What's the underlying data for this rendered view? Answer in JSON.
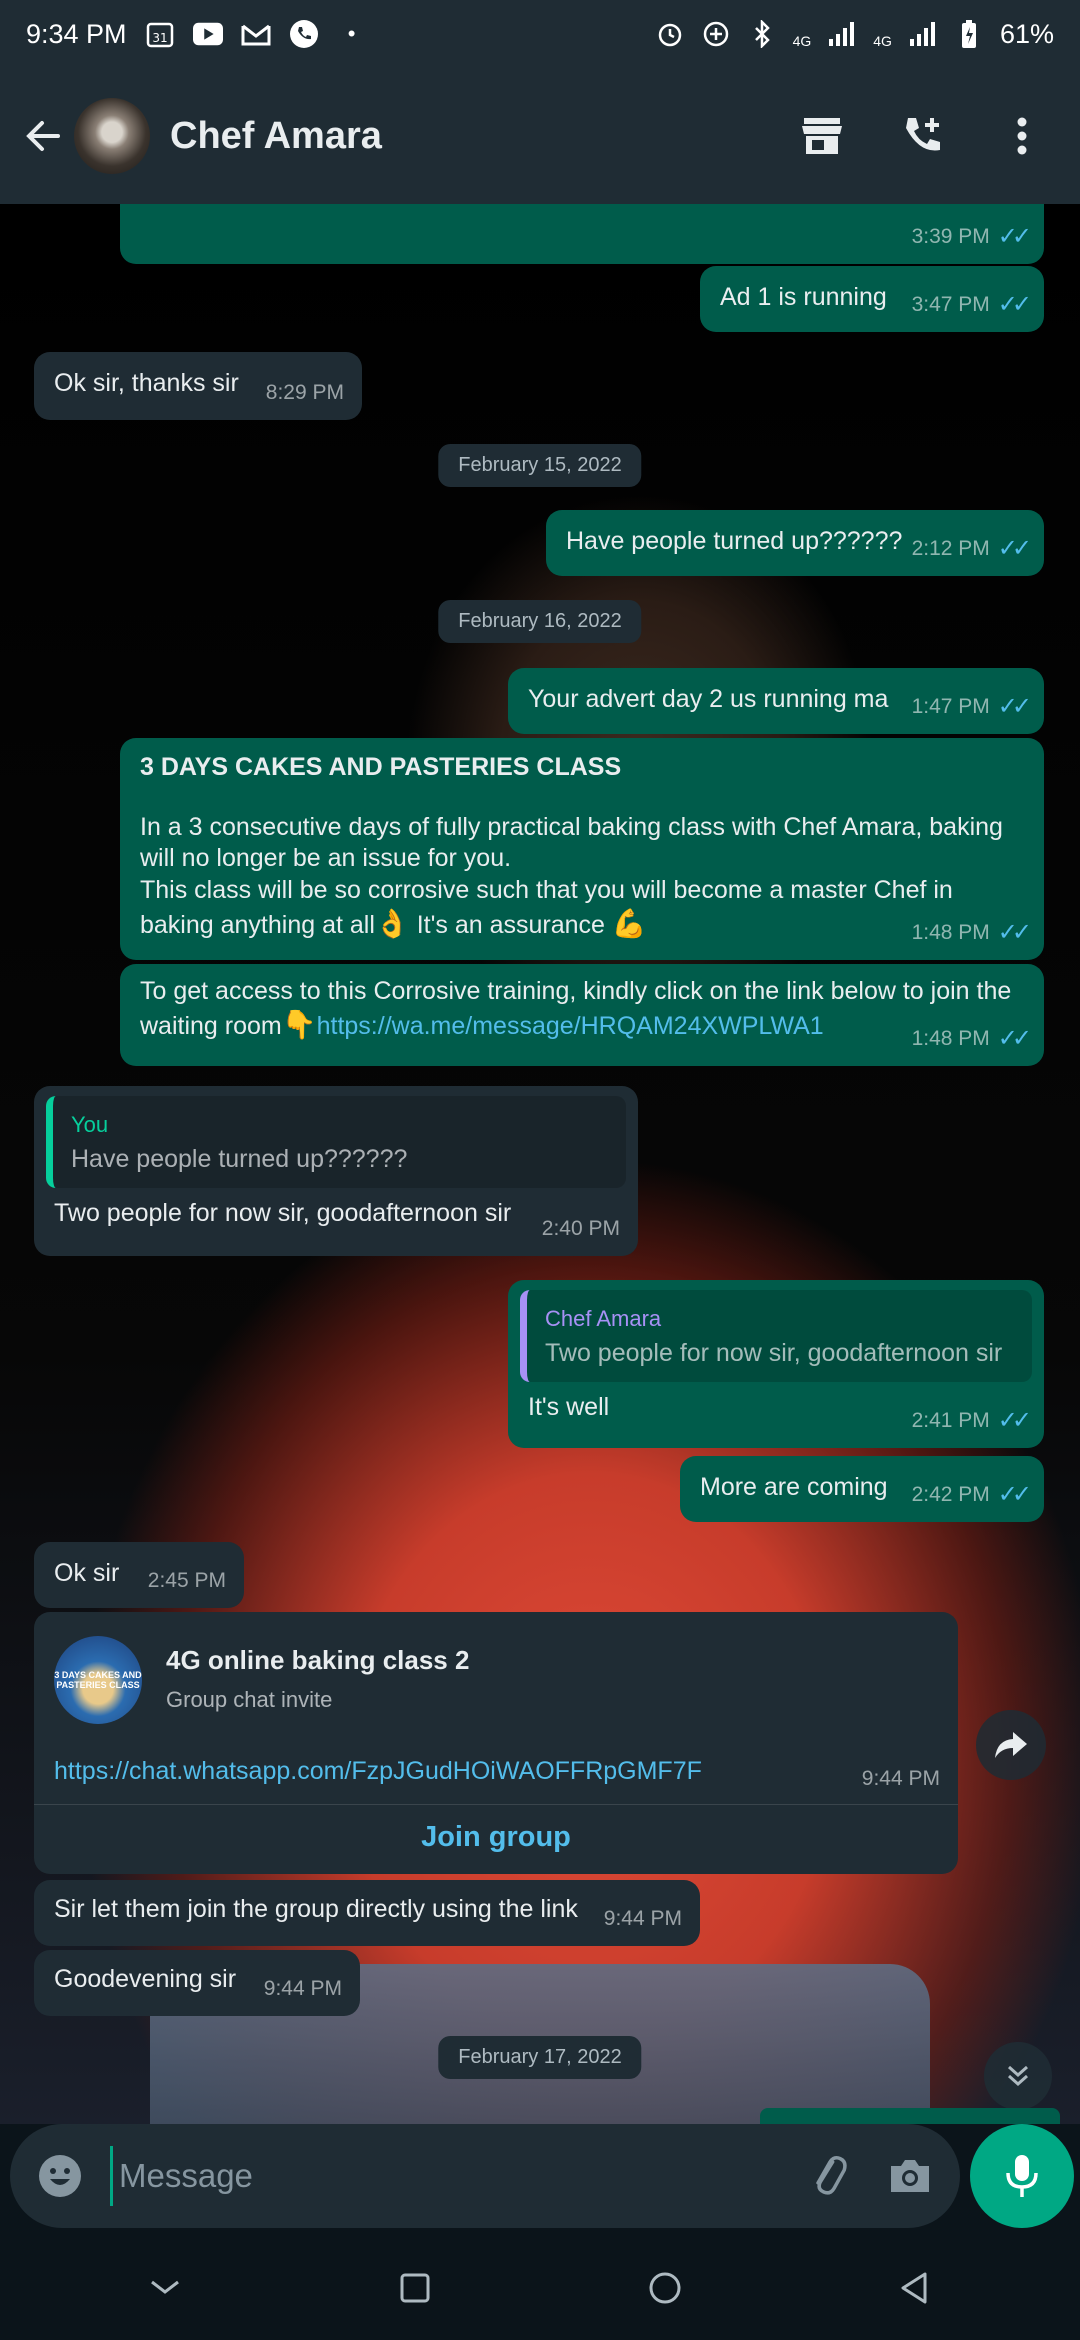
{
  "status_bar": {
    "time": "9:34 PM",
    "calendar_day": "31",
    "network_1": "4G",
    "network_2": "4G",
    "battery": "61%"
  },
  "header": {
    "contact_name": "Chef Amara"
  },
  "messages": [
    {
      "id": "m0",
      "direction": "out",
      "text": "",
      "time": "3:39 PM"
    },
    {
      "id": "m1",
      "direction": "out",
      "text": "Ad 1 is running",
      "time": "3:47 PM"
    },
    {
      "id": "m2",
      "direction": "in",
      "text": "Ok sir, thanks sir",
      "time": "8:29 PM"
    },
    {
      "id": "m3",
      "direction": "out",
      "text": "Have people turned up??????",
      "time": "2:12 PM"
    },
    {
      "id": "m4",
      "direction": "out",
      "text": "Your advert day 2 us running ma",
      "time": "1:47 PM"
    },
    {
      "id": "m5",
      "direction": "out",
      "title": "3 DAYS CAKES AND PASTERIES CLASS",
      "line1": "In a 3 consecutive days of fully practical baking class with Chef Amara, baking will no longer be an issue for you.",
      "line2": "This class will be so corrosive such that you will become a master Chef in baking anything at all",
      "emoji1": "👌",
      "line3": " It's an assurance",
      "emoji2": "💪",
      "time": "1:48 PM"
    },
    {
      "id": "m6",
      "direction": "out",
      "text": "To get access to this Corrosive training, kindly click on the link below to join the waiting room",
      "emoji": "👇",
      "link": "https://wa.me/message/HRQAM24XWPLWA1",
      "time": "1:48 PM"
    },
    {
      "id": "m7",
      "direction": "in",
      "quote_name": "You",
      "quote_text": "Have people turned up??????",
      "text": "Two people for now sir, goodafternoon sir",
      "time": "2:40 PM"
    },
    {
      "id": "m8",
      "direction": "out",
      "quote_name": "Chef Amara",
      "quote_text": "Two people for now sir, goodafternoon sir",
      "text": "It's well",
      "time": "2:41 PM"
    },
    {
      "id": "m9",
      "direction": "out",
      "text": "More are coming",
      "time": "2:42 PM"
    },
    {
      "id": "m10",
      "direction": "in",
      "text": "Ok sir",
      "time": "2:45 PM"
    },
    {
      "id": "m11",
      "direction": "in",
      "card_title": "4G online baking class 2",
      "card_sub": "Group chat invite",
      "thumb_text": "3 DAYS CAKES AND PASTERIES CLASS",
      "link": "https://chat.whatsapp.com/FzpJGudHOiWAOFFRpGMF7F",
      "time": "9:44 PM",
      "action": "Join group"
    },
    {
      "id": "m12",
      "direction": "in",
      "text": "Sir let them join the group directly using the link",
      "time": "9:44 PM"
    },
    {
      "id": "m13",
      "direction": "in",
      "text": "Goodevening sir",
      "time": "9:44 PM"
    }
  ],
  "dates": [
    "February 15, 2022",
    "February 16, 2022",
    "February 17, 2022"
  ],
  "composer": {
    "placeholder": "Message"
  },
  "colors": {
    "outgoing_bubble": "#005c4b",
    "incoming_bubble": "#1f2c34",
    "accent": "#00a884",
    "read_ticks": "#53bdeb",
    "quote_you": "#06cf9c",
    "quote_contact": "#a791f5"
  },
  "icons": [
    "back-arrow-icon",
    "shop-icon",
    "add-call-icon",
    "more-vert-icon",
    "double-check-icon",
    "forward-icon",
    "scroll-down-icon",
    "emoji-icon",
    "attach-icon",
    "camera-icon",
    "mic-icon",
    "nav-recents-icon",
    "nav-home-icon",
    "nav-back-icon"
  ]
}
